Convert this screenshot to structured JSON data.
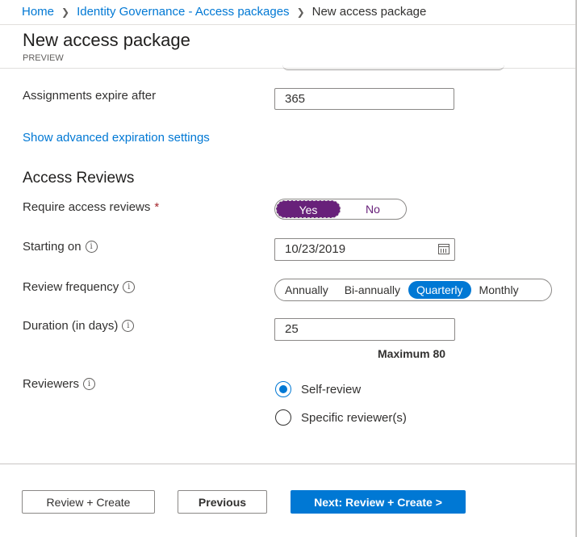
{
  "breadcrumb": {
    "items": [
      "Home",
      "Identity Governance - Access packages",
      "New access package"
    ]
  },
  "header": {
    "title": "New access package",
    "subtitle": "PREVIEW"
  },
  "expiration": {
    "label": "Assignments expire after",
    "value": "365",
    "advanced_link": "Show advanced expiration settings"
  },
  "access_reviews": {
    "heading": "Access Reviews",
    "require": {
      "label": "Require access reviews",
      "required_marker": "*",
      "options": [
        "Yes",
        "No"
      ],
      "selected": "Yes"
    },
    "starting_on": {
      "label": "Starting on",
      "value": "10/23/2019"
    },
    "frequency": {
      "label": "Review frequency",
      "options": [
        "Annually",
        "Bi-annually",
        "Quarterly",
        "Monthly"
      ],
      "selected": "Quarterly"
    },
    "duration": {
      "label": "Duration (in days)",
      "value": "25",
      "maximum": "Maximum 80"
    },
    "reviewers": {
      "label": "Reviewers",
      "options": [
        "Self-review",
        "Specific reviewer(s)"
      ],
      "selected": "Self-review"
    }
  },
  "footer": {
    "review_create": "Review + Create",
    "previous": "Previous",
    "next": "Next: Review + Create >"
  },
  "colors": {
    "accent": "#0078d4",
    "toggle_selected": "#68217a",
    "required": "#a4262c"
  },
  "icons": {
    "breadcrumb_separator": "chevron-right-icon",
    "info": "info-icon",
    "date_picker": "calendar-icon"
  }
}
